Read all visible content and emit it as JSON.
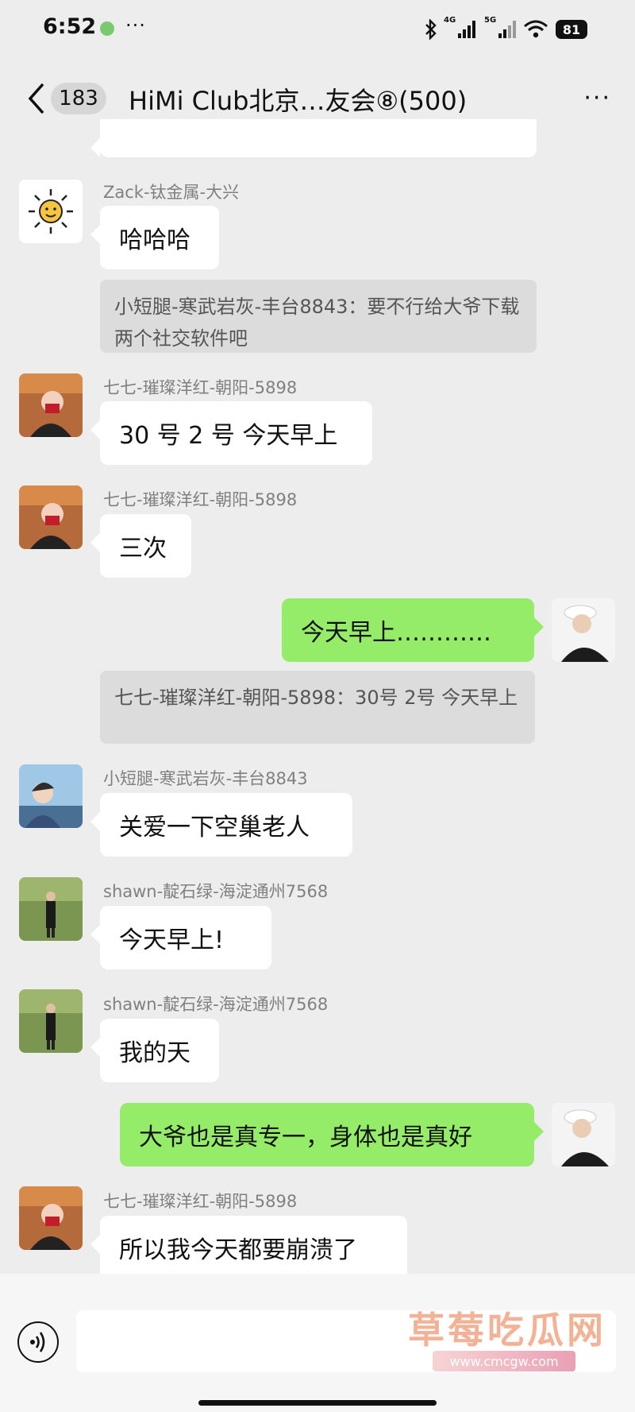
{
  "status_bar": {
    "time": "6:52",
    "dots": "···",
    "net1": "4G",
    "net2": "5G",
    "battery": "81"
  },
  "header": {
    "unread_count": "183",
    "title": "HiMi Club北京…友会⑧(500)",
    "more": "···"
  },
  "messages": [
    {
      "sender": "Zack-钛金属-大兴",
      "text": "哈哈哈"
    },
    {
      "quote": "小短腿-寒武岩灰-丰台8843：要不行给大爷下载两个社交软件吧"
    },
    {
      "sender": "七七-璀璨洋红-朝阳-5898",
      "text": "30 号 2 号 今天早上"
    },
    {
      "sender": "七七-璀璨洋红-朝阳-5898",
      "text": "三次"
    },
    {
      "self": true,
      "text": "今天早上…………"
    },
    {
      "quote": "七七-璀璨洋红-朝阳-5898：30号 2号 今天早上"
    },
    {
      "sender": "小短腿-寒武岩灰-丰台8843",
      "text": "关爱一下空巢老人"
    },
    {
      "sender": "shawn-靛石绿-海淀通州7568",
      "text": "今天早上!"
    },
    {
      "sender": "shawn-靛石绿-海淀通州7568",
      "text": "我的天"
    },
    {
      "self": true,
      "text": "大爷也是真专一，身体也是真好"
    },
    {
      "sender": "七七-璀璨洋红-朝阳-5898",
      "text": "所以我今天都要崩溃了"
    }
  ],
  "watermark": {
    "text": "草莓吃瓜网",
    "url": "www.cmcgw.com"
  },
  "colors": {
    "self_bubble": "#95ec69",
    "background": "#ededed"
  }
}
